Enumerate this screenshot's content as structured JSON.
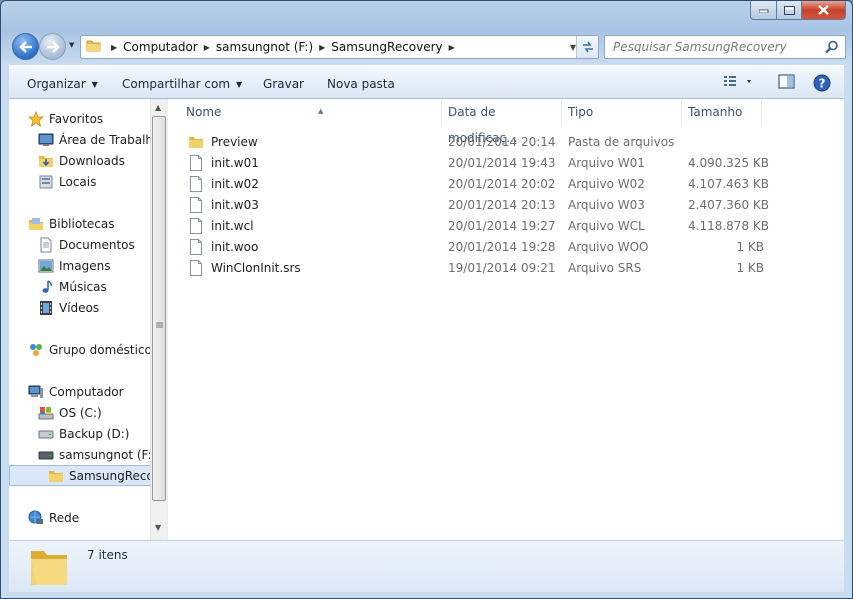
{
  "window": {
    "minimize_icon": "minimize-icon",
    "maximize_icon": "maximize-icon",
    "close_icon": "close-icon"
  },
  "nav": {
    "back_icon": "back-arrow-icon",
    "forward_icon": "forward-arrow-icon"
  },
  "address": {
    "crumbs": [
      "Computador",
      "samsungnot (F:)",
      "SamsungRecovery"
    ]
  },
  "search": {
    "placeholder": "Pesquisar SamsungRecovery"
  },
  "toolbar": {
    "organize": "Organizar",
    "share": "Compartilhar com",
    "burn": "Gravar",
    "new_folder": "Nova pasta"
  },
  "sidebar": {
    "favorites": "Favoritos",
    "desktop": "Área de Trabalho",
    "downloads": "Downloads",
    "places": "Locais",
    "libraries": "Bibliotecas",
    "documents": "Documentos",
    "pictures": "Imagens",
    "music": "Músicas",
    "videos": "Vídeos",
    "homegroup": "Grupo doméstico",
    "computer": "Computador",
    "drive_c": "OS (C:)",
    "drive_d": "Backup (D:)",
    "drive_f": "samsungnot (F:)",
    "current_folder": "SamsungRecovery",
    "network": "Rede"
  },
  "columns": {
    "name": "Nome",
    "date": "Data de modificaç...",
    "type": "Tipo",
    "size": "Tamanho"
  },
  "files": [
    {
      "name": "Preview",
      "date": "20/01/2014 20:14",
      "type": "Pasta de arquivos",
      "size": "",
      "kind": "folder"
    },
    {
      "name": "init.w01",
      "date": "20/01/2014 19:43",
      "type": "Arquivo W01",
      "size": "4.090.325 KB",
      "kind": "file"
    },
    {
      "name": "init.w02",
      "date": "20/01/2014 20:02",
      "type": "Arquivo W02",
      "size": "4.107.463 KB",
      "kind": "file"
    },
    {
      "name": "init.w03",
      "date": "20/01/2014 20:13",
      "type": "Arquivo W03",
      "size": "2.407.360 KB",
      "kind": "file"
    },
    {
      "name": "init.wcl",
      "date": "20/01/2014 19:27",
      "type": "Arquivo WCL",
      "size": "4.118.878 KB",
      "kind": "file"
    },
    {
      "name": "init.woo",
      "date": "20/01/2014 19:28",
      "type": "Arquivo WOO",
      "size": "1 KB",
      "kind": "file"
    },
    {
      "name": "WinClonInit.srs",
      "date": "19/01/2014 09:21",
      "type": "Arquivo SRS",
      "size": "1 KB",
      "kind": "file"
    }
  ],
  "status": {
    "count": "7 itens"
  }
}
